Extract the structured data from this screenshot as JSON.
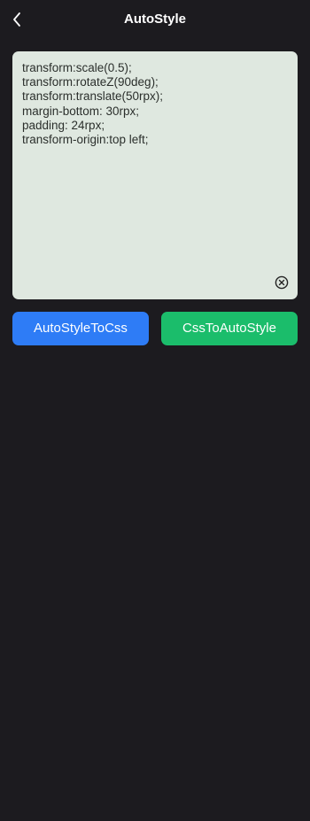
{
  "nav": {
    "title": "AutoStyle",
    "back_icon": "chevron-left-icon"
  },
  "editor": {
    "value": "transform:scale(0.5);\ntransform:rotateZ(90deg);\ntransform:translate(50rpx);\nmargin-bottom: 30rpx;\npadding: 24rpx;\ntransform-origin:top left;",
    "clear_icon": "close-circle-icon"
  },
  "actions": {
    "to_css_label": "AutoStyleToCss",
    "to_autostyle_label": "CssToAutoStyle"
  },
  "colors": {
    "background": "#1c1b1f",
    "editor_background": "#dfe8e0",
    "primary_blue": "#2e7cf6",
    "primary_green": "#1bbd6b"
  }
}
